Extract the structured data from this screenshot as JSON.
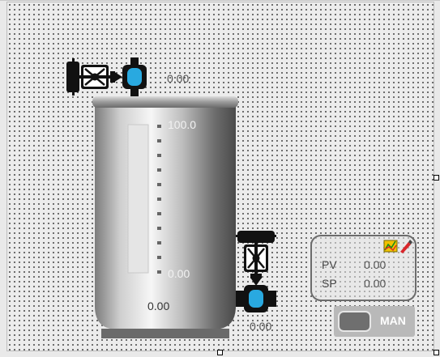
{
  "tank": {
    "level_value": "0.00",
    "scale_max": "100.0",
    "scale_min": "0.00",
    "level_fraction": 0.0
  },
  "inlet_valve": {
    "value": "0.00"
  },
  "outlet_valve": {
    "value": "0.00"
  },
  "pid": {
    "pv_label": "PV",
    "pv_value": "0.00",
    "sp_label": "SP",
    "sp_value": "0.00"
  },
  "mode_button": {
    "label": "MAN"
  },
  "colors": {
    "valve_accent": "#29a9e0",
    "tank_body": "#b8b8b8",
    "pid_icon_red": "#d9262b",
    "pid_icon_yellow": "#f2c200"
  }
}
